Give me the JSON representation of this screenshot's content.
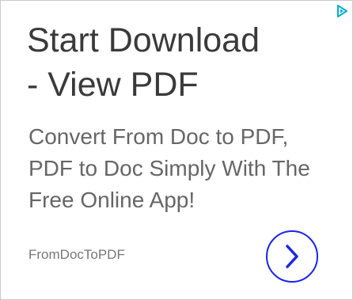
{
  "ad": {
    "headline_line1": "Start Download",
    "headline_line2": "- View PDF",
    "body_line1": "Convert From Doc to PDF,",
    "body_line2": "PDF to Doc Simply With The",
    "body_line3": "Free Online App!",
    "advertiser": "FromDocToPDF",
    "cta_icon": "chevron-right-icon",
    "adchoices_icon": "adchoices-icon"
  },
  "colors": {
    "accent": "#1a26e8",
    "adchoices": "#00aecd",
    "headline": "#3a3a3a",
    "body": "#666666",
    "border": "#c9c9c9"
  }
}
